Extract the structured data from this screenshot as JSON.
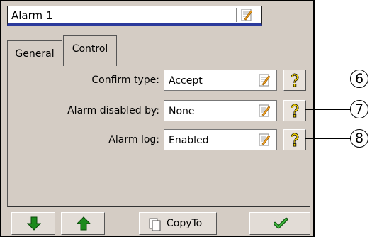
{
  "header": {
    "title": "Alarm 1"
  },
  "tabs": [
    {
      "label": "General"
    },
    {
      "label": "Control"
    }
  ],
  "rows": [
    {
      "label": "Confirm type:",
      "value": "Accept",
      "callout": "6"
    },
    {
      "label": "Alarm disabled by:",
      "value": "None",
      "callout": "7"
    },
    {
      "label": "Alarm log:",
      "value": "Enabled",
      "callout": "8"
    }
  ],
  "toolbar": {
    "copy_label": "CopyTo"
  },
  "icons": {
    "edit": "edit-icon",
    "help": "help-icon",
    "down": "arrow-down-icon",
    "up": "arrow-up-icon",
    "copy": "copy-icon",
    "ok": "checkmark-icon"
  },
  "colors": {
    "panel": "#d4ccc4",
    "arrow_green": "#1c8a1c",
    "help_yellow": "#f2d200",
    "title_underline": "#2b3a9c"
  }
}
